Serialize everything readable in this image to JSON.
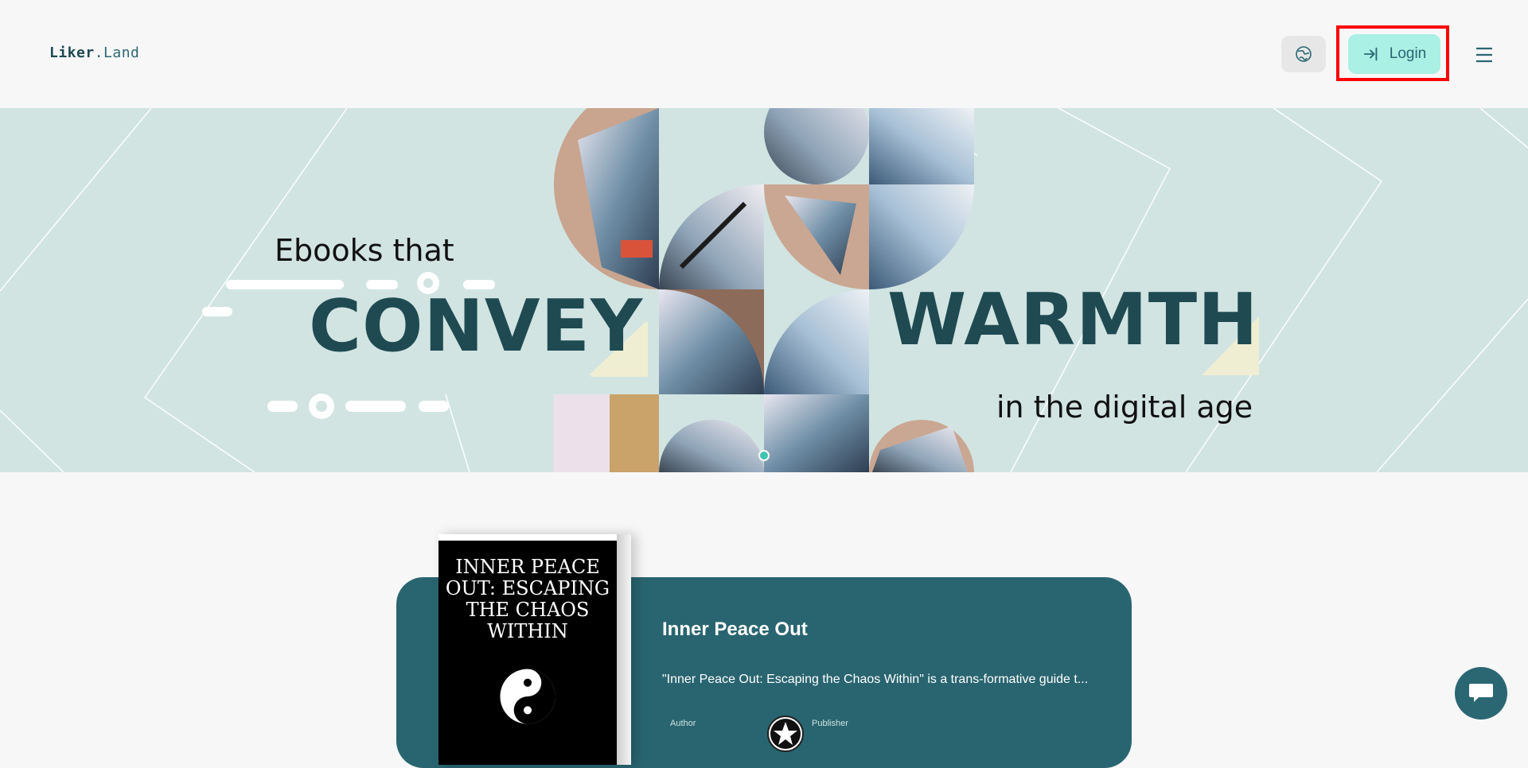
{
  "header": {
    "logo_main": "Liker",
    "logo_suffix": ".Land",
    "login_label": "Login"
  },
  "hero": {
    "line1": "Ebooks that",
    "word1": "CONVEY",
    "word2": "WARMTH",
    "line2": "in the digital age",
    "colors": {
      "background": "#d1e4e2",
      "heading": "#1f4a52",
      "accent": "#40c4b2"
    }
  },
  "book": {
    "cover_title": "INNER PEACE OUT: ESCAPING THE CHAOS WITHIN",
    "title": "Inner Peace Out",
    "description": "\"Inner Peace Out: Escaping the Chaos Within\" is a trans-formative guide t...",
    "author_label": "Author",
    "publisher_label": "Publisher"
  },
  "icons": {
    "language": "globe-icon",
    "login": "login-arrow-icon",
    "menu": "hamburger-menu-icon",
    "chat": "chat-bubble-icon"
  }
}
